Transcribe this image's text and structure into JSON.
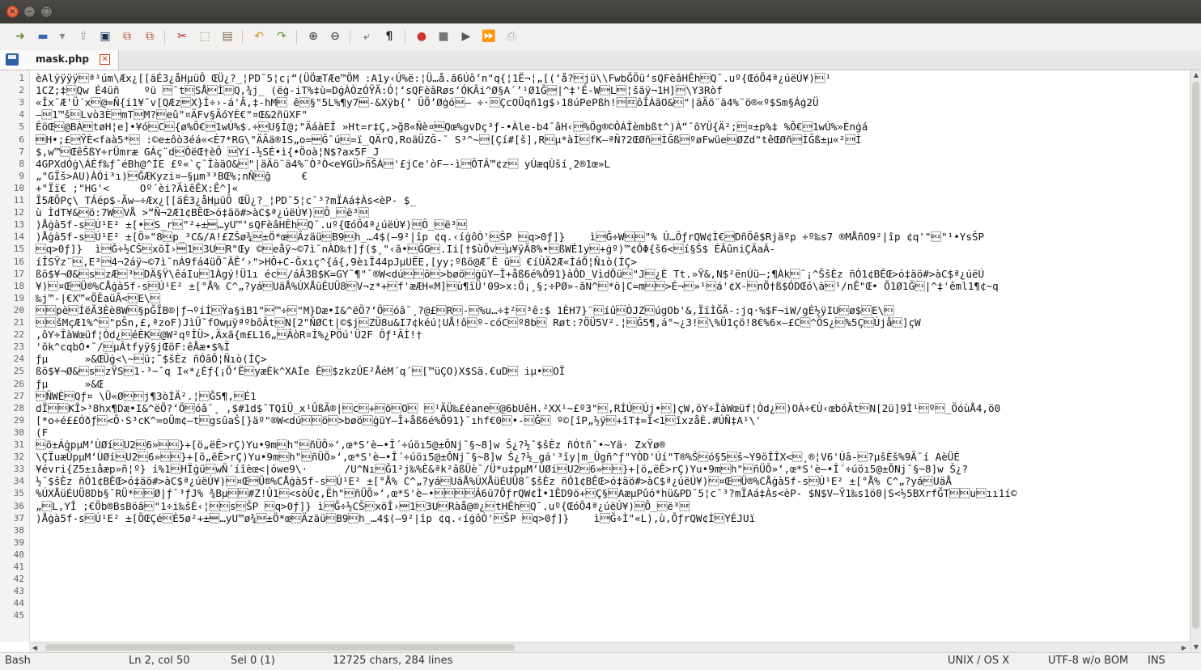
{
  "window": {
    "title": ""
  },
  "toolbar": {
    "icons": [
      "new-file-icon",
      "open-file-icon",
      "close-file-icon",
      "save-icon",
      "save-as-icon",
      "save-all-icon",
      "cut-icon",
      "copy-icon",
      "paste-icon",
      "undo-icon",
      "redo-icon",
      "zoom-in-icon",
      "zoom-out-icon",
      "word-wrap-icon",
      "show-whitespace-icon",
      "record-macro-icon",
      "stop-macro-icon",
      "play-macro-icon",
      "play-macro-multiple-icon",
      "save-macro-icon"
    ]
  },
  "tab": {
    "label": "mask.php"
  },
  "editor": {
    "line_numbers": [
      "1",
      "2",
      "3",
      "4",
      "5",
      "6",
      "7",
      "8",
      "9",
      "10",
      "11",
      "12",
      "13",
      "14",
      "15",
      "16",
      "17",
      "18",
      "19",
      "20",
      "21",
      "22",
      "23",
      "24",
      "25",
      "26",
      "27",
      "28",
      "29",
      "30",
      "31",
      "32",
      "33",
      "34",
      "35",
      "36",
      "37",
      "38",
      "39",
      "40",
      "41",
      "42",
      "43",
      "44",
      "45"
    ],
    "lines": [
      "èAlÿÿÿÿ\u0011ª¹úm\\Æx¿[[äÉ3¿åHµüÔ ŒÜ¿?_¦PD¯5¦c¡“(ÜÖæTÆe™ÖM :A1y‹Ú%ë:¦Ü…å.ã6Úô’n\"q{¦1Ë¬¦„[(‘å?\u0014jü\\\\FwbĞÖü‘sQFèâHÊh\u0012Q¯.uº{ŒóÕ4ª¿úëÚ¥)\u0011¹",
      "1CZ;‡\u0013Qw É4üñ    ºü \u0002¯t\u0012SÅ\u0014Ì\u000eQ,¾j_ (ëġ-iT%‡ù=DġÀÒzÓŸÄ:Ó¦‘sQFèâRøs‘ÓKÃi^Ø§A´’¹Ø1Ğ\u0001|^‡'Ê-W\u0016L\u0003¦šäÿ¬1H]\u0002\\Y3Ròf",
      "«Îx¯Æ'Ü´x\u0013@=Ñ{í1¥˘v[QÆz\u0019X}Í÷›-á'Â,‡-hM\u0011 ê\u0010§\"5L%¶y7\u0015-&Xÿb{’ ÛÖ’Øġó\u0010— ÷·\u000eÇcOÜqñ1g$›18úPePßh!\u0002\u000fôÎÀãO&\u0011\"|äÄö¨ä4%¨ö®«º$Sm§Áġ2Ü",
      "—\u00101™š\u0013Lvò3È\u0016mT\u0010M?\u0003eû\"¤ÄFv§ÄóYÈ€\"¤Œ&2ñüXF\"",
      "ÊöŒ\u0011@BÀ\u0017tøH¦e]•¥ó\u0011C\u0011{ø%Õ€\u00161wÚ%$.÷\u0014U§Í@;\"ÄáàEÎ »Ht=r‡Ç,>ğ8«Ñè¤\u0007Qœ%gvDç³ƒ-•Àle-b4¯âH‹\u0016%Ög®©ÔÁÎèmbßt^)À“¯õYÜ{Ä²;\u0003¤±p%‡ %Õ€\u00161wÚ%»Ènġá",
      "\u0017H•;£\u0016ŸÈ<faà5*\u0013 :©e±ôò3éá«<È7*RG\\\"ÄÄä®1S„o=\u0015Ğ¯ú\u0011=ï_QÄrQ,RoäÜZĞ-¯ S³^~\u0016[Çí#[š],R\u0012µ*àÌ\u0012fK—ªÑ?2ŒØñ\u0016ÌĞß\u0016ºøFwüe\u0011ØZd\"têŒØñ\u0016ÌĞß±µ«²\u0016Ì",
      "$,w™\u0013ŒêŠßY÷rÜmræ GÁç¨d\u0014ÕëŒ†èÖ \u0010Yí-½SÉ•ì{•Öoà¦N$?ax5F_J",
      "4GPXdÓġ\\ÁÉf‰ƒ¯éBh@^ÍE £º«`ç¯ÎàãO&\u0011\"|äÄö¨ä4%¨Ò³Ò<e¥GÜ>ñŠÁ\u0016'£jCe'òF—-ì\u0016ÔTÂ™¢z\u0011 yÚæqÙší¸2®1œ»L",
      "„\"GÏš>AU)ÀÓi³ı)\u0014ĞÆKyzi¤—§µm³³BŒ%;nÑ\u0011ğ     €",
      "+\"Ïï€ ;\"HG'<     Oº´èi?ÄìêÊX:Ê^]«",
      "Î5ÆÕPç\\ TÁép$-Äw—÷Æx¿[[äÉ3¿åHµüÔ ŒÜ¿?_¦PD¯5¦c¯³?mÏAá‡Às<èP- $_",
      "ù ÌdT¥&\u0014ö:7W\u0011VÅ >“Ñ¬2Æ1¢BÊŒ>ó‡äö#>àC$ª¿úëÚ¥)\u0010Ô_\u0013ë³\u0010",
      ")Åġà5f-s\u0012Ú¹E² ±[•\u0014S_r\u0014\"²+±\u0015…yU™‘sQFèâHÊh\u0012Q¯.uº{ŒóÕ4ª¿úëÚ¥)\u0010Ô_\u0013ë³\u0010",
      ")Åġà5f-s\u0012Ú¹E² ±[Õ»\"8\u0011p_³C&/A!£ZŠø¾\u0010±Ö*œ\u0012Äzäü\u0012B9\u0011h_…4$(—9²|îp ¢q.‹íġôÒ'\u0011ŠP \u0011q>0ƒ]}    ì\u0016Ğ÷W\u0011\u0011\"% Ú…ÕƒrQW¢Ì€\u0016DñÕê$Rjäºp ÷º‰s7 ®MÅñO9²|îp ¢q'\"\u0012\"¹•YsŠP",
      "\u0011q>0ƒ]}  ì\u0016Ğ÷½CŠ\u0011xõÎ›\u00151\u00113U\u0011R\"Œy ©\u0011eåÿ~©7ì¯nÀD‰†]ƒ($¸\"‹ã•\u0011ĞG\u0011.Ii[†$ùÖv\u0011µ¥ÿÄ8%•\u0012ßWÉ1y\u0011+ġº)™¢ÔΦ{š6<\u0011í§Š$ ÉÂûniÇÄaÂ-",
      "íÎSŸz¨\u0011,E³\u00164¬2áÿ~©7ì¯nÀ9fá4üÕ¯ÂÊ‘›\">HÔ+C-Ĝxıç^{á{,9èıÏ44pJµUËE,[yy;ºßö@Æ¯Ë ü\u0011 €íÙÄ2Æ«ÍáÕ¦Ñıò(ÍÇ>",
      "ßõ$¥¬Ø&\u0011s\u0011zÆ\u0011³\u0011DÄ§Ÿ\\êáIu\u00111Àgý!Ü1ı éc\u0012/áÃ3B$K=GY¯¶\"¯®W<dú\u0011\u0011ö\u0011>bøö\u0011ġüY—Î+åß6é%Õ91}àÕD_VìdÕü\u0011\"J\u0012¿È Tt.»Ÿ&,N$²ënÚü—;¶Àk\u0011¯¡^ŠšÈz ñÓ1¢BÊŒ>ó‡äö#>àC$ª¿úëÚ",
      "¥)\u0011¤Œ\u0016Ü®%CÅġà5f-s\u0012Ú¹E² ±[°Å% C^„?yá\u0012UäÅ%ÚXÅüÉUÜ8\u0011V¬z*+\u0011f'æÆH«M]\u0011ù¶ïÜ'09>x:Ö¡¸§;÷PØ»-ãN^\u0011*ö|C=m\u0011\u0011>É¬\u0011»¹\u0011á'¢X-\u0011nÖ†ß$ÓDŒó\\à\u0011¹/nÊ\"Œ• Õ1Ø1Ğ\u0011|^‡'êml1¶¢~q",
      "‰j™-|€X™«ÖÊaüÃ<\u0011E\\\u0011",
      "\u0011\u0011pè\u0011ÍëÃ3Èè8W\u0011§pĞÏB®|ƒ¬ºíÍ\u0011Ÿa§iB1\"\u0014™÷\u0011\"M}Dæ•I&^ëÕ?‘Ö\u0012óâ¯¸?@£\u0011R\u0011-\u0011%u…÷‡²\u0011³ê:$ 1ÈH7}¨\u0011íû\u0011ÒJZ\u0011úgOb'&,ÏïÌĞÃ-:jq·%$F¬iW/gÉ½ÿIU\u0011ø$\u0011E\\\u0011",
      "\u0011\u0011šMçÆ1%^\u0011\"pŠn,£,ªzoF)JìÜ˜fOwµÿªºbôÂt\u0011N[2\"ÑØCt|©$j\u0011ZÜ8u&I7¢kéú¦UÅ!ô\u0011º-cóC\u0011º8b\u0011 Røt:?ÖÜ5V².¦\u0011Ğ5¶,á°~¿3!\u0011\\%Ü1çö!8€%6×—£C\u0011^ÕS¿\u0011%5Ç\u0011Újå\u0011]çW",
      ",ôY÷ÎàWœüf¦Òd¿\u0011éÈK\u0011@W²qºÎÜ>,Äxã{m£L16„\u0011ÂòR¤Ì%¿PÖú'Ü2F Ôƒ¹ÂÌ!†",
      "'ök^cqbÒ•¯/\u0011µÂtfyÿ§jŒöF:êÅæ•$%Ï",
      "ƒµ      »&ŒÜġ<\\~\u0011ü;˜$šÈz ñÓâÕ¦Ñıò(ÍÇ>",
      "ßõ$¥¬Ø&\u0011s\u0011zŸS\u00111-³~¯q I«*¿Èƒ{¡Ö‘Ë\u0011yæÈk^XAÍe Ê\u0011$zkzÛE²ÅéM´q´\u0011[™üÇO)X$Sä.€uD\u0011 iµ•\u0011OÏ",
      "ƒµ      »&Œ",
      "\u0011ÑWÈ\u0011Qƒ¤ \\Ü«Ø\u0011\u0011j¶3òÌÄ².¦\u0011Ğ5¶,\u0011É1",
      "dÏ\u0011\u0011KÎ>³8hx¶Dæ•I&^ëÕ?‘Ö\u0012óâ¯¸ ,$#1d$¯TQîÜ_x¹ÛßÃ®|\u0011c\u0011+\u0011ö\u0011O\u0011 \u0011¹ÄÜ‰£éane\u0011@6bUêH.²XX¹~£º3\"\u0011,RÍÚ\u0011Új•\u0011]çW,öY÷ÎàWœüf¦Òd¿\u0011)OÀ÷€Ù‹œbóÃt\u0011N[2ü]9Ì¹\u0011º\u0011_ÖóùÅ4,ö0",
      "[*o÷é££Óðƒ\u0011<Õ·S³cK^=oÜm¢—t\u0011gsûaŠ[}äº\"®W<dú\u0011\u0011ö\u0011>bøö\u0011ġüY—Î+åß6é%Õ91}¯ıhf€0\u0011•-\u0011Ğ\u0011 º©[îP„½ÿ\u0011+îT‡=Ï<1\u0011îxzåÈ.#ÚÑ‡A¹\\'",
      "(F",
      "\u0011ö±ÁġpµM‘ÙØí\u0011U2\u00116»\u0011\u0011}+[ö„ëÊ>rÇ)Yu•9m\u0011h\"\u0011ñÜÕ»‘,œ*S'è—•Î´÷úöı5@±ÕNj¯§~8]w Š¿?½¯$šÈz ñÓtñ¯•~Yä· ZxŸø®",
      "\\ÇÏuæÜpµM‘ÙØí\u0011U2\u00116»\u0011\u0011}+[ö„ëÊ>rÇ)Yu•9m\u0011h\"\u0011ñÜÕ»‘,œ*S'è—•Î´÷úöı5@±ÕNj¯§~8]w Š¿?½_gá'³îy|m_Ûgñ^ƒ\"YÒD'Úí\"T®%Š\u0011ó§5\u0011š~Y9öÎÎX<\u0011¸®¦V6'Úâ-\u0011?µšÈš%9Ã¯í AèÜÈ",
      "¥évri{Z5±ıåæp»ñ¦º} í%1\u0011HÏġü\u0011wÑ´íîèœ<|ówe9\\·      /U^Nı\u0011Ğ1²j‰%È&ªk²âßÜè¯/Ü*u‡pµM‘ÙØí\u0011U2\u00116»\u0011\u0011}+[ö„ëÊ>rÇ)Yu•9m\u0011h\"\u0011ñÜÕ»‘,œ*S'è—•Î´÷úöı5@±ÕNj¯§~8]w Š¿?",
      "½¯$šÈz ñÓ1¢BÊŒ>ó‡äö#>àC$ª¿úëÚ¥)\u0011¤Œ\u0016Ü®%CÅġà5f-s\u0012Ú¹E² ±[°Å% C^„?yá\u0012UäÅ%ÚXÅüÉUÜ8¯$šÈz ñÓ1¢BÊŒ>ó‡äö#>àC$ª¿úëÚ¥)\u0011¤Œ\u0016Ü®%CÅġà5f-s\u0012Ú¹E² ±[°Å% C^„?yá\u0012UäÅ",
      "%ÚXÅüÉUÜ8Db§¯RÜ*\u0011\u0011Ø|ƒ¯³ƒJ% ¾Bµ\u0011\u0011#Z!Û1\u0011<sòÛ¢,Ëh\"\u0011ñÜÕ»‘,œ*S'è—•\u0011\u0011\u0011\u0011Â6ü7ÕƒrQW¢Ì•1ÊD9ö+\u0011Ç§\u0011AæµPûó*hü&PD¯5¦c¯³?mÏAá‡Às<èP- $N$V—Ÿ1‰s1ö0|S<½5BXrfĞT\u0011\u0011u\u0011ıı1í©",
      "„\u0011L,YÎ ;€Öb®BsBöã\u0011\"1÷i‰šÈ‹¦\u0011\u0011s\u0011ŠP \u0011q>0ƒ]} ì\u0016Ğ÷½CŠ\u0011xõÎ›\u00151\u00113U\u0011Ràå@®¿\u0011tHÊh\u0011Q¯.uº{ŒóÕ4ª¿úëÚ¥)\u0010Ô_\u0013ë³\u0010",
      ")Åġà5f-s\u0012Ú¹E² ±[ÖŒÇé\u0011È5ø²+±\u0015…yU™ø¾\u0010±Ö*œ\u0012Äzäü\u0012B9\u0011h_…4$(—9²|îp ¢q.‹íġôÒ'\u0011ŠP \u0011q>0ƒ]}    ì\u0016Ğ÷Ì\"«L),ù,ÕƒrQW¢Ì\u0011YÉJUï",
      ""
    ]
  },
  "status": {
    "language": "Bash",
    "position": "Ln 2, col 50",
    "selection": "Sel 0 (1)",
    "stats": "12725 chars, 284 lines",
    "line_endings": "UNIX / OS X",
    "encoding": "UTF-8 w/o BOM",
    "insert_mode": "INS"
  },
  "colors": {
    "accent": "#2f5fa6",
    "close": "#df4a16"
  }
}
